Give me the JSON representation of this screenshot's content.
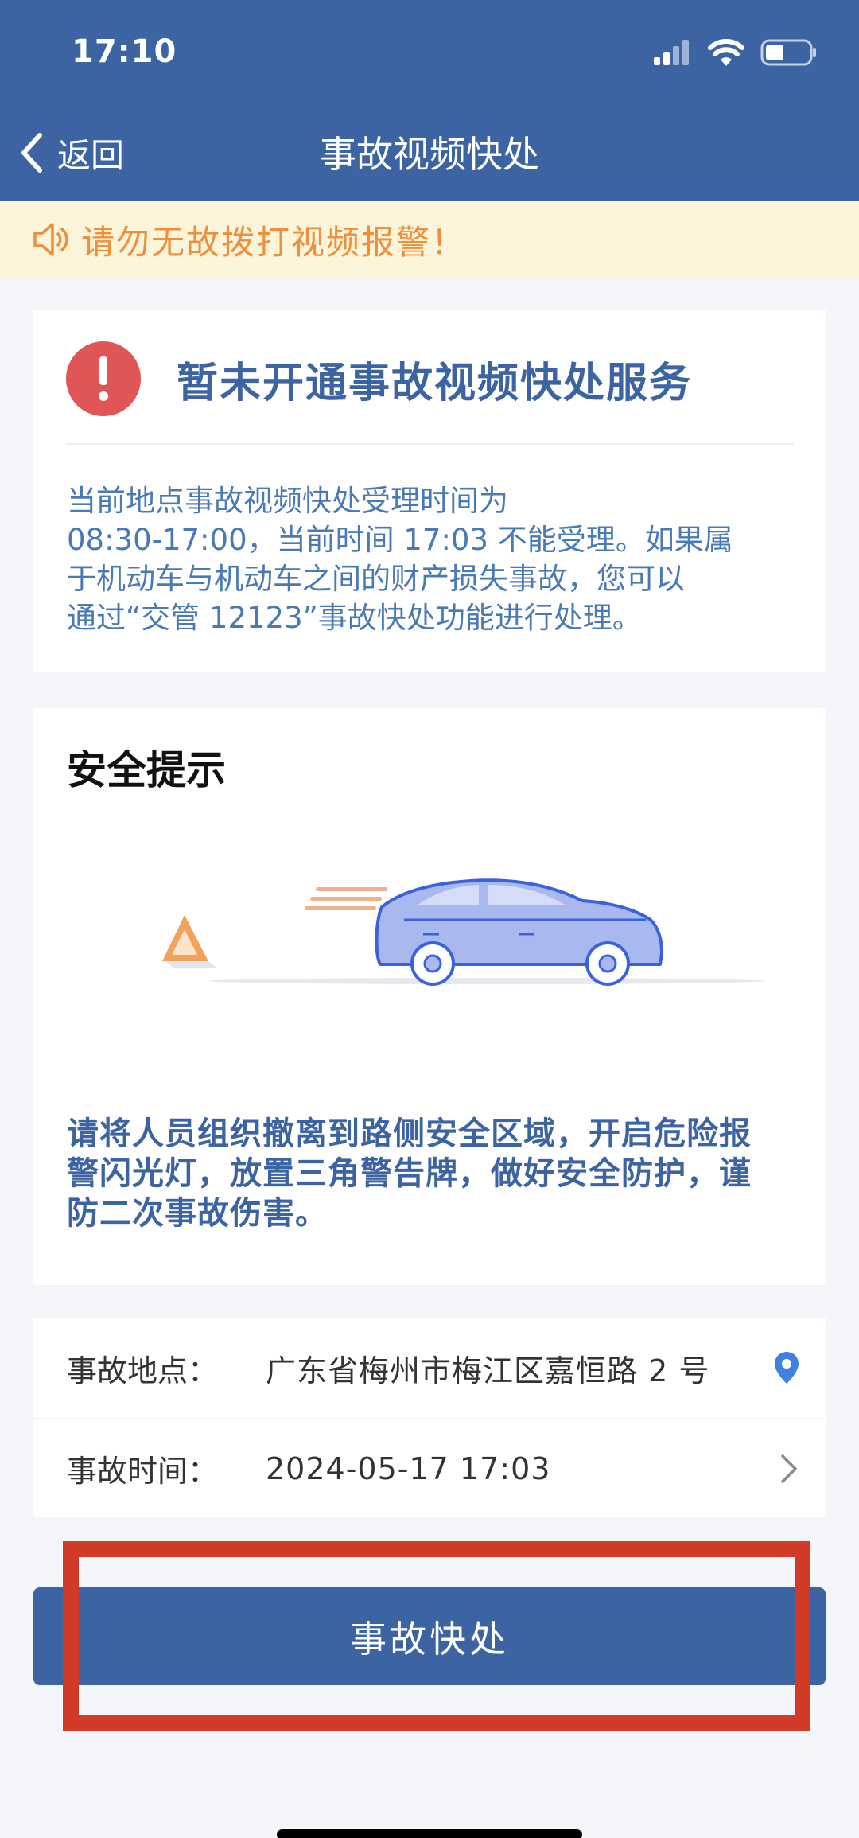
{
  "status_bar": {
    "time": "17:10"
  },
  "nav": {
    "back_label": "返回",
    "title": "事故视频快处"
  },
  "notice": {
    "text": "请勿无故拨打视频报警！"
  },
  "service_card": {
    "title": "暂未开通事故视频快处服务",
    "lines": [
      "当前地点事故视频快处受理时间为",
      "08:30-17:00，当前时间 17:03 不能受理。如果属",
      "于机动车与机动车之间的财产损失事故，您可以",
      "通过“交管 12123”事故快处功能进行处理。"
    ]
  },
  "safety_card": {
    "title": "安全提示",
    "lines": [
      "请将人员组织撤离到路侧安全区域，开启危险报",
      "警闪光灯，放置三角警告牌，做好安全防护，谨",
      "防二次事故伤害。"
    ]
  },
  "accident_info": {
    "location_label": "事故地点：",
    "location_value": "广东省梅州市梅江区嘉恒路 2 号",
    "time_label": "事故时间：",
    "time_value": "2024-05-17 17:03"
  },
  "action": {
    "button_label": "事故快处"
  },
  "colors": {
    "primary": "#3c64a3",
    "notice_text": "#ee8f3c",
    "alert_red": "#e05555",
    "highlight": "#d03a26"
  },
  "icons": [
    "cellular-icon",
    "wifi-icon",
    "battery-icon",
    "back-chevron-icon",
    "speaker-icon",
    "exclamation-icon",
    "location-pin-icon",
    "chevron-right-icon"
  ]
}
